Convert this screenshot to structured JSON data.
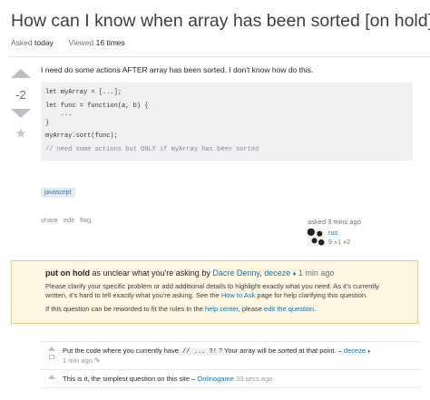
{
  "question": {
    "title": "How can I know when array has been sorted [on hold]",
    "asked_label": "Asked",
    "asked_value": "today",
    "viewed_label": "Viewed",
    "viewed_value": "16 times",
    "votes": "-2",
    "body": "I need do some actions AFTER array has been sorted. I don't know how do this.",
    "code_lines": [
      "let myArray = [...];",
      "",
      "let func = function(a, b) {",
      "    ...",
      "}",
      "",
      "myArray.sort(func);",
      "",
      "// need some actions but ONLY if myArray has been sorted"
    ],
    "tag": "javascript",
    "menu": [
      "share",
      "edit",
      "flag"
    ]
  },
  "owner": {
    "asked": "asked 3 mins ago",
    "name": "rus",
    "reputation": "9",
    "silver_badges": "1",
    "bronze_badges": "2",
    "badge_dot": "●"
  },
  "notice": {
    "status": "put on hold",
    "reason": "as unclear what you're asking",
    "by": "by",
    "closers": [
      "Dacre Denny",
      "deceze"
    ],
    "diamond": "♦",
    "separator": ",",
    "time": "1 min ago",
    "p1_a": "Please clarify your specific problem or add additional details to highlight exactly what you need. As it's currently",
    "p1_b_pre": "written, it's hard to tell exactly what you're asking. See the",
    "p1_link": "How to Ask",
    "p1_b_post": "page for help clarifying this question.",
    "p2_pre": "If this question can be reworded to fit the rules in the",
    "p2_link1": "help center",
    "p2_mid": ", please",
    "p2_link2": "edit the question",
    "p2_end": "."
  },
  "comments": [
    {
      "pre": "Put the code where you currently have",
      "code": "// ... ?!",
      "post": "? Your array will be sorted at that point. –",
      "author": "deceze",
      "diamond": "♦",
      "time": "1 min ago",
      "edited_icon": "✎"
    },
    {
      "text": "This is it, the simplest question on this site –",
      "author": "Onlinogame",
      "time": "33 secs ago"
    }
  ],
  "icons": {
    "upvote": "upvote-arrow-icon",
    "downvote": "downvote-arrow-icon",
    "favorite": "★",
    "pencil": "pencil-icon"
  },
  "colors": {
    "link": "#0077cc",
    "notice_bg": "#fdf7e2",
    "notice_border": "#e6cf79",
    "tag_bg": "#e1ecf4",
    "tag_text": "#39739d"
  }
}
